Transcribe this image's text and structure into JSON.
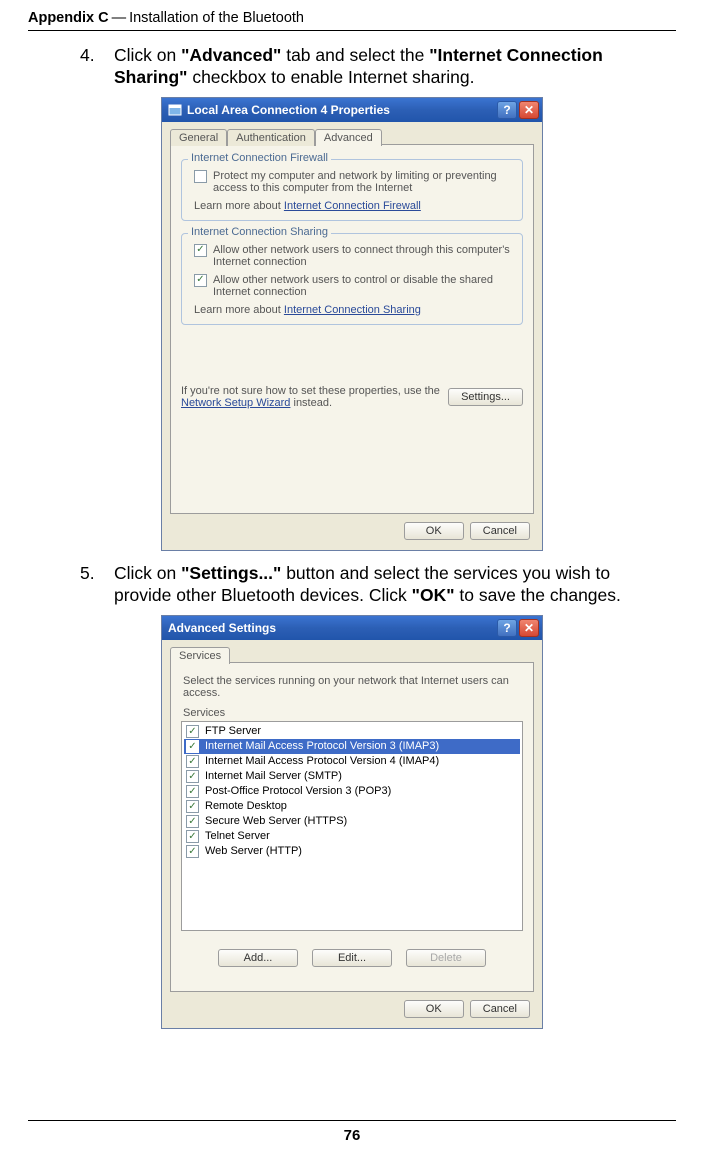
{
  "header": {
    "appendix": "Appendix C",
    "sep": "—",
    "title": "Installation of the Bluetooth"
  },
  "steps": [
    {
      "n": "4.",
      "pre": "Click on ",
      "b1": "\"Advanced\"",
      "mid": " tab and select the ",
      "b2": "\"Internet Connection Sharing\"",
      "post": " checkbox to enable Internet sharing."
    },
    {
      "n": "5.",
      "pre": "Click on ",
      "b1": "\"Settings...\"",
      "mid": " button and select the services you wish to provide other Bluetooth devices. Click ",
      "b2": "\"OK\"",
      "post": " to save the changes."
    }
  ],
  "dlg1": {
    "title": "Local Area Connection 4 Properties",
    "help": "?",
    "close": "✕",
    "tabs": [
      "General",
      "Authentication",
      "Advanced"
    ],
    "group1": {
      "legend": "Internet Connection Firewall",
      "chk1": "Protect my computer and network by limiting or preventing access to this computer from the Internet",
      "learn": "Learn more about ",
      "link": "Internet Connection Firewall"
    },
    "group2": {
      "legend": "Internet Connection Sharing",
      "chk1": "Allow other network users to connect through this computer's Internet connection",
      "chk2": "Allow other network users to control or disable the shared Internet connection",
      "learn": "Learn more about ",
      "link": "Internet Connection Sharing"
    },
    "hint_pre": "If you're not sure how to set these properties, use the ",
    "hint_link": "Network Setup Wizard",
    "hint_post": " instead.",
    "settings": "Settings...",
    "ok": "OK",
    "cancel": "Cancel"
  },
  "dlg2": {
    "title": "Advanced Settings",
    "help": "?",
    "close": "✕",
    "tab": "Services",
    "desc": "Select the services running on your network that Internet users can access.",
    "svc_label": "Services",
    "services": [
      {
        "name": "FTP Server",
        "checked": true,
        "selected": false
      },
      {
        "name": "Internet Mail Access Protocol Version 3 (IMAP3)",
        "checked": true,
        "selected": true
      },
      {
        "name": "Internet Mail Access Protocol Version 4 (IMAP4)",
        "checked": true,
        "selected": false
      },
      {
        "name": "Internet Mail Server (SMTP)",
        "checked": true,
        "selected": false
      },
      {
        "name": "Post-Office Protocol Version 3 (POP3)",
        "checked": true,
        "selected": false
      },
      {
        "name": "Remote Desktop",
        "checked": true,
        "selected": false
      },
      {
        "name": "Secure Web Server (HTTPS)",
        "checked": true,
        "selected": false
      },
      {
        "name": "Telnet Server",
        "checked": true,
        "selected": false
      },
      {
        "name": "Web Server (HTTP)",
        "checked": true,
        "selected": false
      }
    ],
    "add": "Add...",
    "edit": "Edit...",
    "delete": "Delete",
    "ok": "OK",
    "cancel": "Cancel"
  },
  "footer": {
    "page": "76"
  }
}
